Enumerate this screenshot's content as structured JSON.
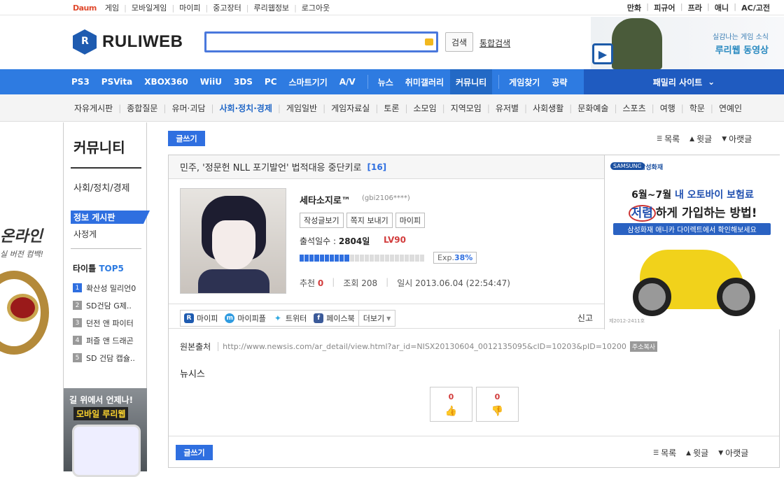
{
  "topbar": {
    "daum": "Daum",
    "left_links": [
      "게임",
      "모바일게임",
      "마이피",
      "중고장터",
      "루리웹정보"
    ],
    "logout": "로그아웃",
    "right_links": [
      "만화",
      "피규어",
      "프라",
      "애니",
      "AC/고전"
    ]
  },
  "header": {
    "logo_text": "RULIWEB",
    "search_value": "",
    "search_button": "검색",
    "integrated_search": "통합검색",
    "banner_line1": "실감나는 게임 소식",
    "banner_line2": "루리웹 동영상"
  },
  "mainnav": {
    "items_a": [
      "PS3",
      "PSVita",
      "XBOX360",
      "WiiU",
      "3DS",
      "PC",
      "스마트기기",
      "A/V"
    ],
    "items_b": [
      "뉴스",
      "취미갤러리",
      "커뮤니티"
    ],
    "items_c": [
      "게임찾기",
      "공략"
    ],
    "active": "커뮤니티",
    "family": "패밀리 사이트"
  },
  "subnav": {
    "items": [
      "자유게시판",
      "종합질문",
      "유머·괴담",
      "사회·정치·경제",
      "게임일반",
      "게임자료실",
      "토론",
      "소모임",
      "지역모임",
      "유저별",
      "사회생활",
      "문화예술",
      "스포츠",
      "여행",
      "학문",
      "연예인"
    ],
    "active": "사회·정치·경제"
  },
  "leftad": {
    "title": "온라인",
    "subtitle": "실 버전 컴백!"
  },
  "sidebar": {
    "title": "커뮤니티",
    "category": "사회/정치/경제",
    "active_board": "정보 게시판",
    "sub_board": "사정게",
    "top5_label": "타이틀",
    "top5_accent": "TOP5",
    "top5": [
      {
        "n": "1",
        "title": "확산성 밀리언0"
      },
      {
        "n": "2",
        "title": "SD건담 G제.."
      },
      {
        "n": "3",
        "title": "던전 앤 파이터"
      },
      {
        "n": "4",
        "title": "퍼즐 앤 드래곤"
      },
      {
        "n": "5",
        "title": "SD 건담 캡슐.."
      }
    ],
    "mobile_ad_line1": "길 위에서 언제나!",
    "mobile_ad_line2": "모바일 루리웹"
  },
  "toolbar": {
    "write": "글쓰기",
    "list": "목록",
    "prev": "윗글",
    "next": "아랫글"
  },
  "post": {
    "title": "민주, '정문헌 NLL 포기발언' 법적대응 중단키로",
    "comment_count": "[16]",
    "author": "세타소지로™",
    "author_id": "(gbi2106****)",
    "author_buttons": [
      "작성글보기",
      "쪽지 보내기",
      "마이피"
    ],
    "attend_label": "출석일수 :",
    "attend_value": "2804일",
    "level": "LV90",
    "exp_label": "Exp.",
    "exp_value": "38%",
    "exp_fraction": 0.38,
    "rec_label": "추천",
    "rec_value": "0",
    "view_label": "조회",
    "view_value": "208",
    "date_label": "일시",
    "date_value": "2013.06.04 (22:54:47)",
    "share": [
      "마이피",
      "마이피플",
      "트위터",
      "페이스북"
    ],
    "more": "더보기",
    "report": "신고",
    "source_label": "원본출처",
    "source_url": "http://www.newsis.com/ar_detail/view.html?ar_id=NISX20130604_0012135095&cID=10203&pID=10200",
    "copy_label": "주소복사",
    "body": "뉴시스",
    "vote_up": "0",
    "vote_down": "0"
  },
  "ad": {
    "brand": "SAMSUNG",
    "brand2": "삼성화재",
    "line1_a": "6월~7월",
    "line1_b": "내 오토바이 보험료",
    "line2_a": "저렴",
    "line2_b": "하게 가입하는 방법!",
    "strip": "삼성화재 애니카 다이렉트에서 확인해보세요",
    "code": "제2012-2411호"
  }
}
